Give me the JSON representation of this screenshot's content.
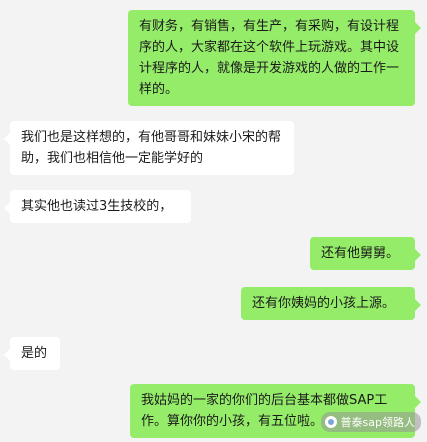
{
  "messages": [
    {
      "side": "out",
      "text": "有财务，有销售，有生产，有采购，有设计程序的人，大家都在这个软件上玩游戏。其中设计程序的人，就像是开发游戏的人做的工作一样的。"
    },
    {
      "side": "in",
      "text": "我们也是这样想的，有他哥哥和妹妹小宋的帮助，我们也相信他一定能学好的"
    },
    {
      "side": "in",
      "text": "其实他也读过3生技校的，"
    },
    {
      "side": "out",
      "text": "还有他舅舅。"
    },
    {
      "side": "out",
      "text": "还有你姨妈的小孩上源。"
    },
    {
      "side": "in",
      "text": "是的"
    },
    {
      "side": "out",
      "text": "我姑妈的一家的你们的后台基本都做SAP工作。算你你的小孩，有五位啦。"
    }
  ],
  "watermark": {
    "text": "普泰sap领路人",
    "icon": "wechat-account-icon"
  },
  "colors": {
    "background": "#f3f3f3",
    "outgoing_bubble": "#95ec69",
    "incoming_bubble": "#ffffff"
  }
}
